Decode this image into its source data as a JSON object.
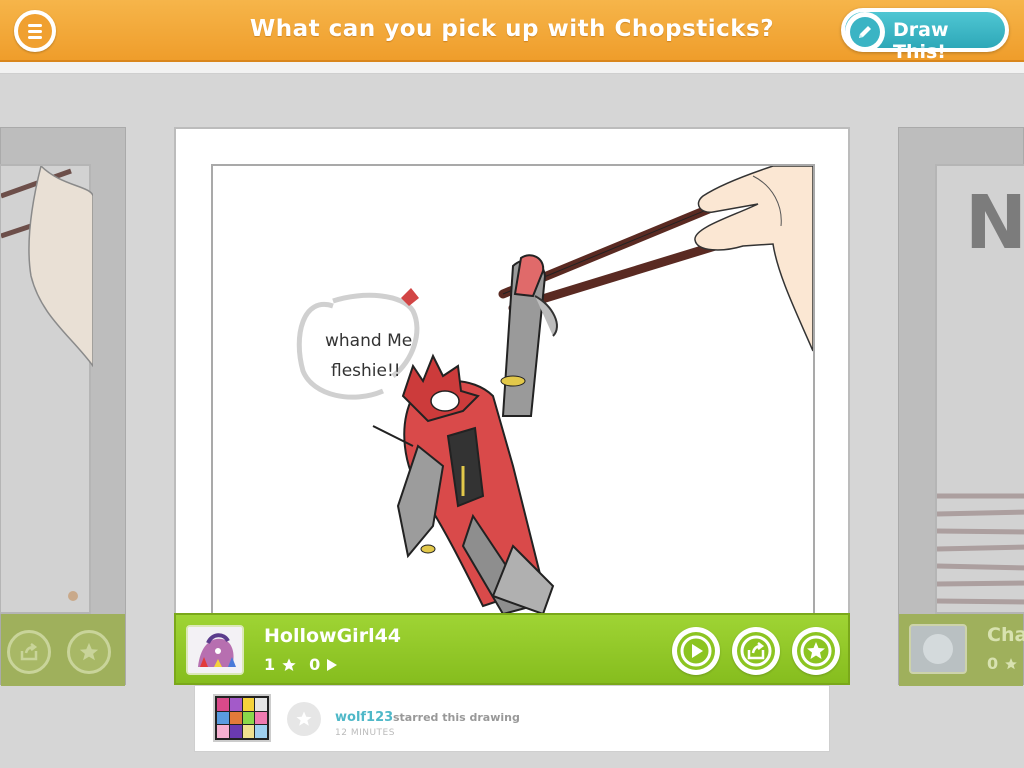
{
  "header": {
    "title": "What can you pick up with Chopsticks?",
    "draw_button_label": "Draw This!",
    "menu_icon": "menu-icon",
    "pencil_icon": "pencil-icon",
    "accent_color": "#f0a030",
    "button_color": "#3bb4c4"
  },
  "drawing": {
    "speech_bubble_line1": "whand Me",
    "speech_bubble_line2": "fleshie!!"
  },
  "main_card": {
    "username": "HollowGirl44",
    "stars": "1",
    "plays": "0",
    "bar_color": "#8cc421",
    "actions": [
      "play-icon",
      "share-icon",
      "star-icon"
    ]
  },
  "right_card": {
    "username": "Cha",
    "stars": "0",
    "canvas_text": "N"
  },
  "activity": {
    "user": "wolf123",
    "text": "starred this drawing",
    "time": "12 MINUTES"
  }
}
